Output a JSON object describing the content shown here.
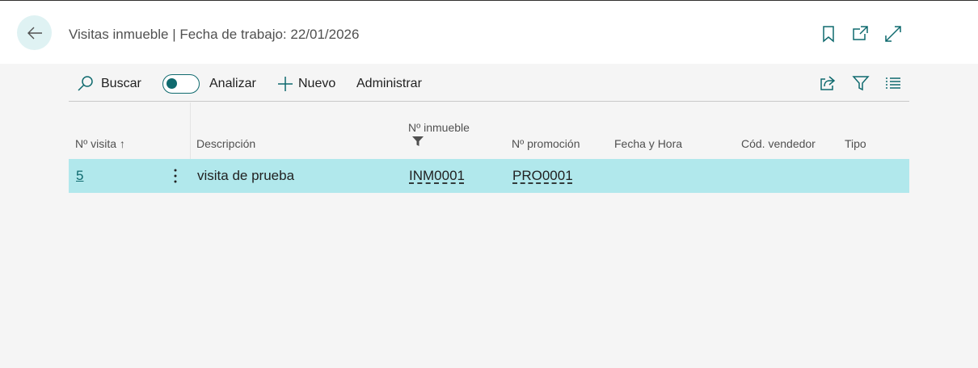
{
  "header": {
    "title": "Visitas inmueble | Fecha de trabajo: 22/01/2026",
    "icons": [
      "back-arrow-icon",
      "bookmark-icon",
      "open-new-window-icon",
      "expand-icon"
    ]
  },
  "toolbar": {
    "search_label": "Buscar",
    "analyze_label": "Analizar",
    "new_label": "Nuevo",
    "manage_label": "Administrar",
    "analyze_toggle_on": false,
    "icons": [
      "share-icon",
      "filter-icon",
      "list-view-icon"
    ]
  },
  "table": {
    "columns": {
      "visit_no": "Nº visita",
      "description": "Descripción",
      "property_no": "Nº inmueble",
      "promotion_no": "Nº promoción",
      "datetime": "Fecha y Hora",
      "seller_code": "Cód. vendedor",
      "type": "Tipo"
    },
    "sort_indicator": "↑",
    "rows": [
      {
        "visit_no": "5",
        "description": "visita de prueba",
        "property_no": "INM0001",
        "promotion_no": "PRO0001",
        "datetime": "",
        "seller_code": "",
        "type": ""
      }
    ]
  },
  "colors": {
    "accent": "#0f6a6e",
    "selected_row": "#b1e8ec",
    "back_button_bg": "#dff2f3"
  }
}
